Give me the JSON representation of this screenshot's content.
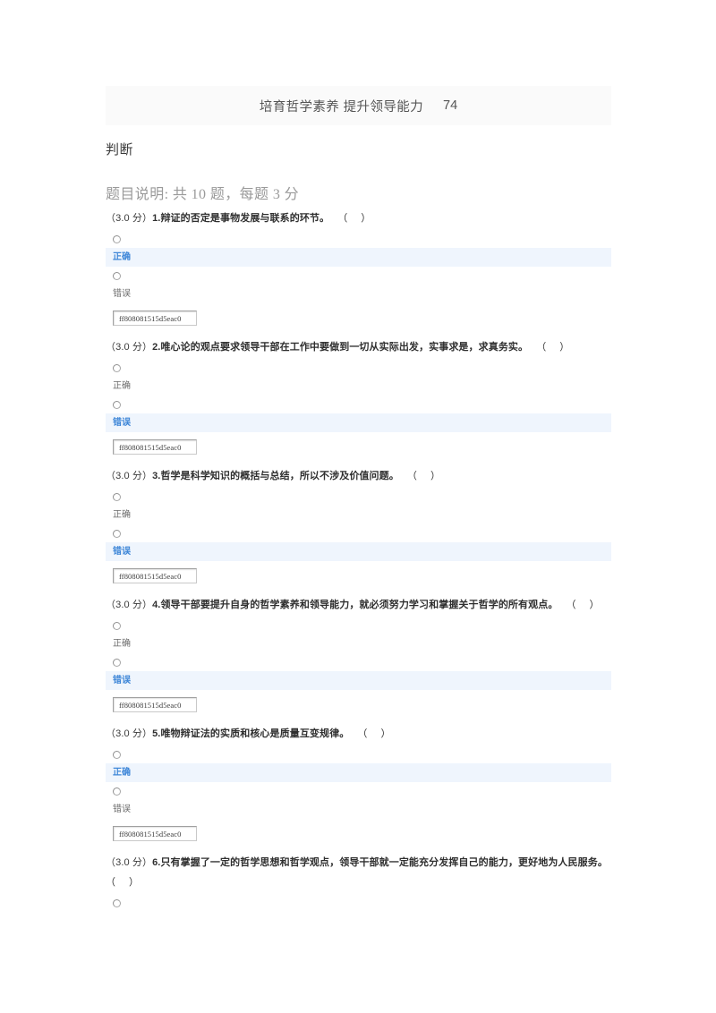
{
  "header": {
    "title": "培育哲学素养 提升领导能力",
    "count": "74"
  },
  "section": {
    "title": "判断",
    "description": "题目说明: 共 10 题，每题 3 分"
  },
  "colors": {
    "highlight_bg": "#eff5fd",
    "highlight_text": "#3f87d8",
    "header_bg": "#fafafa",
    "body_text": "#2f2f2f",
    "muted_text": "#9a9a9a"
  },
  "questions": [
    {
      "score": "（3.0 分）",
      "number": "1.",
      "text": "辩证的否定是事物发展与联系的环节。",
      "blank": "（    ）",
      "options": [
        {
          "label": "正确",
          "selected": true
        },
        {
          "label": "错误",
          "selected": false
        }
      ],
      "answer_value": "ff808081515d5eac0"
    },
    {
      "score": "（3.0 分）",
      "number": "2.",
      "text": "唯心论的观点要求领导干部在工作中要做到一切从实际出发，实事求是，求真务实。",
      "blank": "（    ）",
      "options": [
        {
          "label": "正确",
          "selected": false
        },
        {
          "label": "错误",
          "selected": true
        }
      ],
      "answer_value": "ff808081515d5eac0"
    },
    {
      "score": "（3.0 分）",
      "number": "3.",
      "text": "哲学是科学知识的概括与总结，所以不涉及价值问题。",
      "blank": "（    ）",
      "options": [
        {
          "label": "正确",
          "selected": false
        },
        {
          "label": "错误",
          "selected": true
        }
      ],
      "answer_value": "ff808081515d5eac0"
    },
    {
      "score": "（3.0 分）",
      "number": "4.",
      "text": "领导干部要提升自身的哲学素养和领导能力，就必须努力学习和掌握关于哲学的所有观点。",
      "blank": "（    ）",
      "options": [
        {
          "label": "正确",
          "selected": false
        },
        {
          "label": "错误",
          "selected": true
        }
      ],
      "answer_value": "ff808081515d5eac0"
    },
    {
      "score": "（3.0 分）",
      "number": "5.",
      "text": "唯物辩证法的实质和核心是质量互变规律。",
      "blank": "（    ）",
      "options": [
        {
          "label": "正确",
          "selected": true
        },
        {
          "label": "错误",
          "selected": false
        }
      ],
      "answer_value": "ff808081515d5eac0"
    },
    {
      "score": "（3.0 分）",
      "number": "6.",
      "text": "只有掌握了一定的哲学思想和哲学观点，领导干部就一定能充分发挥自己的能力，更好地为人民服务。",
      "blank": "（    ）",
      "options": [],
      "answer_value": null,
      "partial": true
    }
  ]
}
